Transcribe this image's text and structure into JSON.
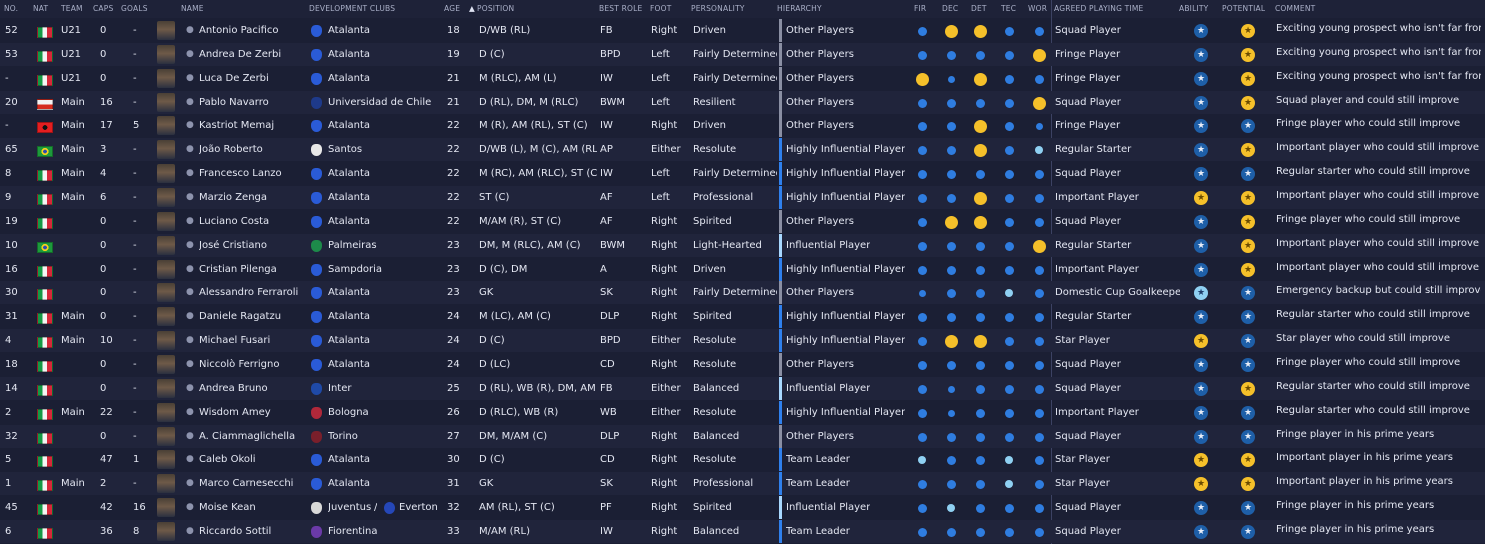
{
  "headers": {
    "no": "NO.",
    "nat": "NAT",
    "team": "TEAM",
    "caps": "CAPS",
    "goals": "GOALS",
    "name": "NAME",
    "dev_clubs": "DEVELOPMENT CLUBS",
    "age": "AGE",
    "sort_arrow": "▲",
    "position": "POSITION",
    "best_role": "BEST ROLE",
    "foot": "FOOT",
    "personality": "PERSONALITY",
    "hierarchy": "HIERARCHY",
    "fir": "FIR",
    "dec": "DEC",
    "det": "DET",
    "tec": "TEC",
    "wor": "WOR",
    "playing_time": "AGREED PLAYING TIME",
    "ability": "ABILITY",
    "potential": "POTENTIAL",
    "comment": "COMMENT"
  },
  "colors": {
    "background": "#1b1f34",
    "row_alt": "#20243b",
    "attr_blue": "#2f7de0",
    "attr_gold": "#f5c02a",
    "attr_light": "#8fd0f2",
    "hier_blue": "#2f80ed",
    "hier_light": "#a8d8ff",
    "hier_grey": "#8a8fa3",
    "star_bg": "#1e5fa8",
    "star_gold": "#f5c02a"
  },
  "players": [
    {
      "no": "52",
      "nat": "italy",
      "team": "U21",
      "caps": "0",
      "goals": "-",
      "name": "Antonio Pacifico",
      "club": "Atalanta",
      "club2": "",
      "age": "18",
      "position": "D/WB (RL)",
      "role": "FB",
      "foot": "Right",
      "personality": "Driven",
      "hierarchy": "Other Players",
      "hier_level": "grey",
      "attrs": [
        "b",
        "g",
        "g",
        "b",
        "b"
      ],
      "playing_time": "Squad Player",
      "ability": "b",
      "potential": "g",
      "comment": "Exciting young prospect who isn't far from..."
    },
    {
      "no": "53",
      "nat": "italy",
      "team": "U21",
      "caps": "0",
      "goals": "-",
      "name": "Andrea De Zerbi",
      "club": "Atalanta",
      "club2": "",
      "age": "19",
      "position": "D (C)",
      "role": "BPD",
      "foot": "Left",
      "personality": "Fairly Determined",
      "hierarchy": "Other Players",
      "hier_level": "grey",
      "attrs": [
        "b",
        "b",
        "b",
        "b",
        "g"
      ],
      "playing_time": "Fringe Player",
      "ability": "b",
      "potential": "g",
      "comment": "Exciting young prospect who isn't far from..."
    },
    {
      "no": "-",
      "nat": "italy",
      "team": "U21",
      "caps": "0",
      "goals": "-",
      "name": "Luca De Zerbi",
      "club": "Atalanta",
      "club2": "",
      "age": "21",
      "position": "M (RLC), AM (L)",
      "role": "IW",
      "foot": "Left",
      "personality": "Fairly Determined",
      "hierarchy": "Other Players",
      "hier_level": "grey",
      "attrs": [
        "g",
        "s",
        "g",
        "b",
        "b"
      ],
      "playing_time": "Fringe Player",
      "ability": "b",
      "potential": "g",
      "comment": "Exciting young prospect who isn't far from..."
    },
    {
      "no": "20",
      "nat": "chile",
      "team": "Main",
      "caps": "16",
      "goals": "-",
      "name": "Pablo Navarro",
      "club": "Universidad de Chile",
      "club2": "",
      "age": "21",
      "position": "D (RL), DM, M (RLC)",
      "role": "BWM",
      "foot": "Left",
      "personality": "Resilient",
      "hierarchy": "Other Players",
      "hier_level": "grey",
      "attrs": [
        "b",
        "b",
        "b",
        "b",
        "g"
      ],
      "playing_time": "Squad Player",
      "ability": "b",
      "potential": "g",
      "comment": "Squad player and could still improve"
    },
    {
      "no": "-",
      "nat": "albania",
      "team": "Main",
      "caps": "17",
      "goals": "5",
      "name": "Kastriot Memaj",
      "club": "Atalanta",
      "club2": "",
      "age": "22",
      "position": "M (R), AM (RL), ST (C)",
      "role": "IW",
      "foot": "Right",
      "personality": "Driven",
      "hierarchy": "Other Players",
      "hier_level": "grey",
      "attrs": [
        "b",
        "b",
        "g",
        "b",
        "s"
      ],
      "playing_time": "Fringe Player",
      "ability": "b",
      "potential": "b",
      "comment": "Fringe player who could still improve"
    },
    {
      "no": "65",
      "nat": "brazil",
      "team": "Main",
      "caps": "3",
      "goals": "-",
      "name": "João Roberto",
      "club": "Santos",
      "club2": "",
      "age": "22",
      "position": "D/WB (L), M (C), AM (RLC)",
      "role": "AP",
      "foot": "Either",
      "personality": "Resolute",
      "hierarchy": "Highly Influential Player",
      "hier_level": "blue",
      "attrs": [
        "b",
        "b",
        "g",
        "b",
        "l"
      ],
      "playing_time": "Regular Starter",
      "ability": "b",
      "potential": "g",
      "comment": "Important player who could still improve"
    },
    {
      "no": "8",
      "nat": "italy",
      "team": "Main",
      "caps": "4",
      "goals": "-",
      "name": "Francesco Lanzo",
      "club": "Atalanta",
      "club2": "",
      "age": "22",
      "position": "M (RC), AM (RLC), ST (C)",
      "role": "IW",
      "foot": "Left",
      "personality": "Fairly Determined",
      "hierarchy": "Highly Influential Player",
      "hier_level": "blue",
      "attrs": [
        "b",
        "b",
        "b",
        "b",
        "b"
      ],
      "playing_time": "Squad Player",
      "ability": "b",
      "potential": "b",
      "comment": "Regular starter who could still improve"
    },
    {
      "no": "9",
      "nat": "italy",
      "team": "Main",
      "caps": "6",
      "goals": "-",
      "name": "Marzio Zenga",
      "club": "Atalanta",
      "club2": "",
      "age": "22",
      "position": "ST (C)",
      "role": "AF",
      "foot": "Left",
      "personality": "Professional",
      "hierarchy": "Highly Influential Player",
      "hier_level": "blue",
      "attrs": [
        "b",
        "b",
        "g",
        "b",
        "b"
      ],
      "playing_time": "Important Player",
      "ability": "g",
      "potential": "g",
      "comment": "Important player who could still improve"
    },
    {
      "no": "19",
      "nat": "italy",
      "team": "",
      "caps": "0",
      "goals": "-",
      "name": "Luciano Costa",
      "club": "Atalanta",
      "club2": "",
      "age": "22",
      "position": "M/AM (R), ST (C)",
      "role": "AF",
      "foot": "Right",
      "personality": "Spirited",
      "hierarchy": "Other Players",
      "hier_level": "grey",
      "attrs": [
        "b",
        "g",
        "g",
        "b",
        "b"
      ],
      "playing_time": "Squad Player",
      "ability": "b",
      "potential": "g",
      "comment": "Fringe player who could still improve"
    },
    {
      "no": "10",
      "nat": "brazil",
      "team": "",
      "caps": "0",
      "goals": "-",
      "name": "José Cristiano",
      "club": "Palmeiras",
      "club2": "",
      "age": "23",
      "position": "DM, M (RLC), AM (C)",
      "role": "BWM",
      "foot": "Right",
      "personality": "Light-Hearted",
      "hierarchy": "Influential Player",
      "hier_level": "light",
      "attrs": [
        "b",
        "b",
        "b",
        "b",
        "g"
      ],
      "playing_time": "Regular Starter",
      "ability": "b",
      "potential": "g",
      "comment": "Important player who could still improve"
    },
    {
      "no": "16",
      "nat": "italy",
      "team": "",
      "caps": "0",
      "goals": "-",
      "name": "Cristian Pilenga",
      "club": "Sampdoria",
      "club2": "",
      "age": "23",
      "position": "D (C), DM",
      "role": "A",
      "foot": "Right",
      "personality": "Driven",
      "hierarchy": "Highly Influential Player",
      "hier_level": "blue",
      "attrs": [
        "b",
        "b",
        "b",
        "b",
        "b"
      ],
      "playing_time": "Important Player",
      "ability": "b",
      "potential": "g",
      "comment": "Important player who could still improve"
    },
    {
      "no": "30",
      "nat": "italy",
      "team": "",
      "caps": "0",
      "goals": "-",
      "name": "Alessandro Ferraroli",
      "club": "Atalanta",
      "club2": "",
      "age": "23",
      "position": "GK",
      "role": "SK",
      "foot": "Right",
      "personality": "Fairly Determined",
      "hierarchy": "Other Players",
      "hier_level": "grey",
      "attrs": [
        "s",
        "b",
        "b",
        "l",
        "b"
      ],
      "playing_time": "Domestic Cup Goalkeeper",
      "ability": "l",
      "potential": "b",
      "comment": "Emergency backup but could still improve"
    },
    {
      "no": "31",
      "nat": "italy",
      "team": "Main",
      "caps": "0",
      "goals": "-",
      "name": "Daniele Ragatzu",
      "club": "Atalanta",
      "club2": "",
      "age": "24",
      "position": "M (LC), AM (C)",
      "role": "DLP",
      "foot": "Right",
      "personality": "Spirited",
      "hierarchy": "Highly Influential Player",
      "hier_level": "blue",
      "attrs": [
        "b",
        "b",
        "b",
        "b",
        "b"
      ],
      "playing_time": "Regular Starter",
      "ability": "b",
      "potential": "b",
      "comment": "Regular starter who could still improve"
    },
    {
      "no": "4",
      "nat": "italy",
      "team": "Main",
      "caps": "10",
      "goals": "-",
      "name": "Michael Fusari",
      "club": "Atalanta",
      "club2": "",
      "age": "24",
      "position": "D (C)",
      "role": "BPD",
      "foot": "Either",
      "personality": "Resolute",
      "hierarchy": "Highly Influential Player",
      "hier_level": "blue",
      "attrs": [
        "b",
        "g",
        "g",
        "b",
        "b"
      ],
      "playing_time": "Star Player",
      "ability": "g",
      "potential": "b",
      "comment": "Star player who could still improve"
    },
    {
      "no": "18",
      "nat": "italy",
      "team": "",
      "caps": "0",
      "goals": "-",
      "name": "Niccolò Ferrigno",
      "club": "Atalanta",
      "club2": "",
      "age": "24",
      "position": "D (LC)",
      "role": "CD",
      "foot": "Right",
      "personality": "Resolute",
      "hierarchy": "Other Players",
      "hier_level": "grey",
      "attrs": [
        "b",
        "b",
        "b",
        "b",
        "b"
      ],
      "playing_time": "Squad Player",
      "ability": "b",
      "potential": "b",
      "comment": "Fringe player who could still improve"
    },
    {
      "no": "14",
      "nat": "italy",
      "team": "",
      "caps": "0",
      "goals": "-",
      "name": "Andrea Bruno",
      "club": "Inter",
      "club2": "",
      "age": "25",
      "position": "D (RL), WB (R), DM, AM (R)",
      "role": "FB",
      "foot": "Either",
      "personality": "Balanced",
      "hierarchy": "Influential Player",
      "hier_level": "light",
      "attrs": [
        "b",
        "s",
        "b",
        "b",
        "b"
      ],
      "playing_time": "Squad Player",
      "ability": "b",
      "potential": "g",
      "comment": "Regular starter who could still improve"
    },
    {
      "no": "2",
      "nat": "italy",
      "team": "Main",
      "caps": "22",
      "goals": "-",
      "name": "Wisdom Amey",
      "club": "Bologna",
      "club2": "",
      "age": "26",
      "position": "D (RLC), WB (R)",
      "role": "WB",
      "foot": "Either",
      "personality": "Resolute",
      "hierarchy": "Highly Influential Player",
      "hier_level": "blue",
      "attrs": [
        "b",
        "s",
        "b",
        "b",
        "b"
      ],
      "playing_time": "Important Player",
      "ability": "b",
      "potential": "b",
      "comment": "Regular starter who could still improve"
    },
    {
      "no": "32",
      "nat": "italy",
      "team": "",
      "caps": "0",
      "goals": "-",
      "name": "A. Ciammaglichella",
      "club": "Torino",
      "club2": "",
      "age": "27",
      "position": "DM, M/AM (C)",
      "role": "DLP",
      "foot": "Right",
      "personality": "Balanced",
      "hierarchy": "Other Players",
      "hier_level": "grey",
      "attrs": [
        "b",
        "b",
        "b",
        "b",
        "b"
      ],
      "playing_time": "Squad Player",
      "ability": "b",
      "potential": "b",
      "comment": "Fringe player in his prime years"
    },
    {
      "no": "5",
      "nat": "italy",
      "team": "",
      "caps": "47",
      "goals": "1",
      "name": "Caleb Okoli",
      "club": "Atalanta",
      "club2": "",
      "age": "30",
      "position": "D (C)",
      "role": "CD",
      "foot": "Right",
      "personality": "Resolute",
      "hierarchy": "Team Leader",
      "hier_level": "blue",
      "attrs": [
        "l",
        "b",
        "b",
        "l",
        "b"
      ],
      "playing_time": "Star Player",
      "ability": "g",
      "potential": "g",
      "comment": "Important player in his prime years"
    },
    {
      "no": "1",
      "nat": "italy",
      "team": "Main",
      "caps": "2",
      "goals": "-",
      "name": "Marco Carnesecchi",
      "club": "Atalanta",
      "club2": "",
      "age": "31",
      "position": "GK",
      "role": "SK",
      "foot": "Right",
      "personality": "Professional",
      "hierarchy": "Team Leader",
      "hier_level": "blue",
      "attrs": [
        "b",
        "b",
        "b",
        "l",
        "b"
      ],
      "playing_time": "Star Player",
      "ability": "g",
      "potential": "g",
      "comment": "Important player in his prime years"
    },
    {
      "no": "45",
      "nat": "italy",
      "team": "",
      "caps": "42",
      "goals": "16",
      "name": "Moise Kean",
      "club": "Juventus",
      "club2": "Everton",
      "age": "32",
      "position": "AM (RL), ST (C)",
      "role": "PF",
      "foot": "Right",
      "personality": "Spirited",
      "hierarchy": "Influential Player",
      "hier_level": "light",
      "attrs": [
        "b",
        "l",
        "b",
        "b",
        "b"
      ],
      "playing_time": "Squad Player",
      "ability": "b",
      "potential": "b",
      "comment": "Fringe player in his prime years"
    },
    {
      "no": "6",
      "nat": "italy",
      "team": "",
      "caps": "36",
      "goals": "8",
      "name": "Riccardo Sottil",
      "club": "Fiorentina",
      "club2": "",
      "age": "33",
      "position": "M/AM (RL)",
      "role": "IW",
      "foot": "Right",
      "personality": "Balanced",
      "hierarchy": "Team Leader",
      "hier_level": "blue",
      "attrs": [
        "b",
        "b",
        "b",
        "b",
        "b"
      ],
      "playing_time": "Squad Player",
      "ability": "b",
      "potential": "b",
      "comment": "Fringe player in his prime years"
    }
  ]
}
